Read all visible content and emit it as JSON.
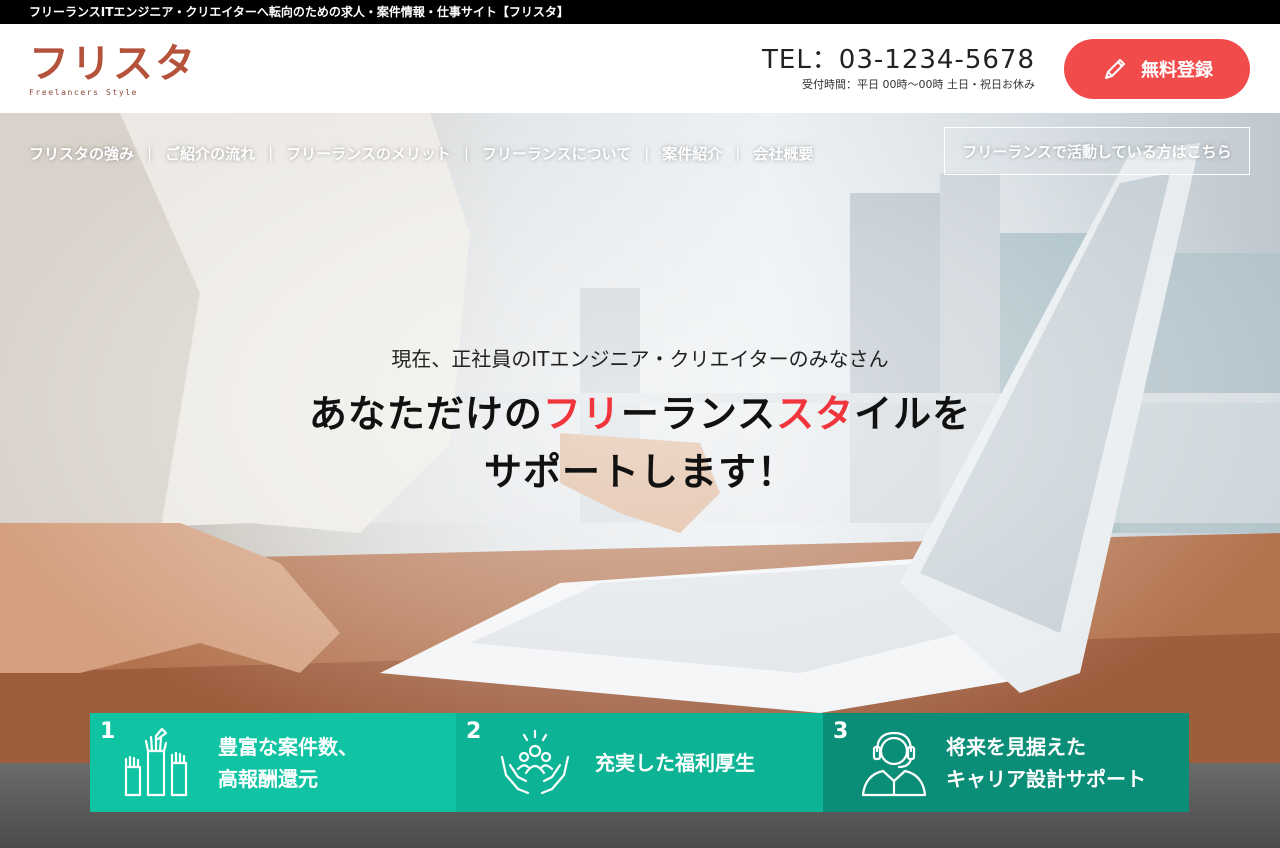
{
  "topbar": {
    "text": "フリーランスITエンジニア・クリエイターへ転向のための求人・案件情報・仕事サイト【フリスタ】"
  },
  "header": {
    "logo_main": "フリスタ",
    "logo_sub": "Freelancers Style",
    "tel": "TEL：03-1234-5678",
    "hours": "受付時間：平日 00時〜00時 土日・祝日お休み",
    "register_label": "無料登録"
  },
  "nav": {
    "items": [
      {
        "label": "フリスタの強み"
      },
      {
        "label": "ご紹介の流れ"
      },
      {
        "label": "フリーランスのメリット"
      },
      {
        "label": "フリーランスについて"
      },
      {
        "label": "案件紹介"
      },
      {
        "label": "会社概要"
      }
    ],
    "separator": "|",
    "active_freelancer_label": "フリーランスで活動している方はこちら"
  },
  "hero": {
    "subtitle": "現在、正社員のITエンジニア・クリエイターのみなさん",
    "title_line1_a": "あなただけの",
    "title_line1_b": "フリ",
    "title_line1_c": "ーランス",
    "title_line1_d": "スタ",
    "title_line1_e": "イルを",
    "title_line2": "サポートします！"
  },
  "features": [
    {
      "num": "1",
      "line1": "豊富な案件数、",
      "line2": "高報酬還元",
      "icon": "hands-raised-icon"
    },
    {
      "num": "2",
      "line1": "充実した福利厚生",
      "line2": "",
      "icon": "hands-holding-people-icon"
    },
    {
      "num": "3",
      "line1": "将来を見据えた",
      "line2": "キャリア設計サポート",
      "icon": "headset-operator-icon"
    }
  ],
  "colors": {
    "accent_red": "#f24b4b",
    "title_red": "#f0353d",
    "logo_brown": "#b5523c",
    "feature1": "#10c4a3",
    "feature2": "#0cb395",
    "feature3": "#0b8e78"
  }
}
